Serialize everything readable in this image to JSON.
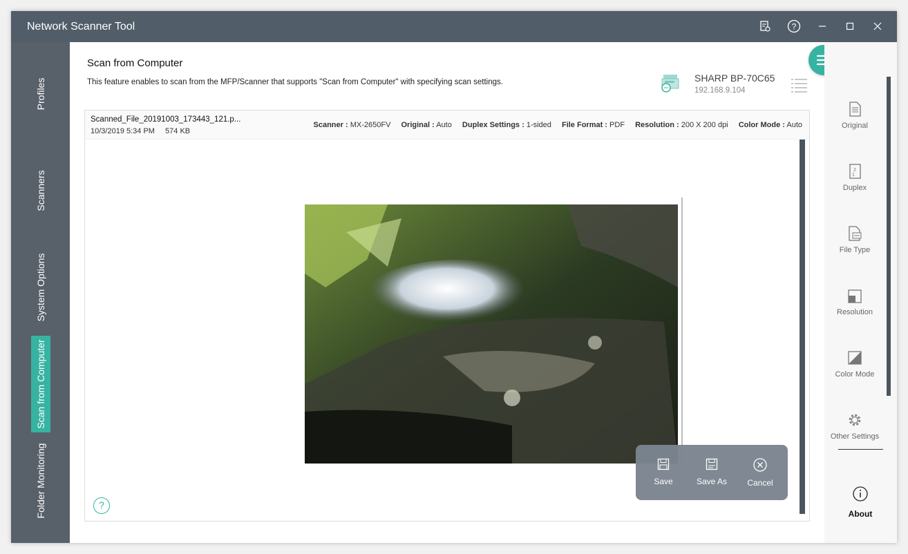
{
  "app": {
    "title": "Network Scanner Tool"
  },
  "titlebar_icons": [
    "license-icon",
    "help-icon",
    "minimize-icon",
    "maximize-icon",
    "close-icon"
  ],
  "left_nav": {
    "tabs": [
      {
        "label": "Profiles",
        "active": false
      },
      {
        "label": "Scanners",
        "active": false
      },
      {
        "label": "System Options",
        "active": false
      },
      {
        "label": "Scan from Computer",
        "active": true
      },
      {
        "label": "Folder Monitoring",
        "active": false
      }
    ]
  },
  "page": {
    "title": "Scan from Computer",
    "description": "This feature enables to scan from the MFP/Scanner that supports \"Scan from Computer\" with specifying scan settings."
  },
  "device": {
    "name": "SHARP BP-70C65",
    "ip": "192.168.9.104"
  },
  "file": {
    "name": "Scanned_File_20191003_173443_121.p...",
    "datetime": "10/3/2019 5:34 PM",
    "size": "574 KB"
  },
  "scan_settings": {
    "scanner_label": "Scanner :",
    "scanner_value": "MX-2650FV",
    "original_label": "Original :",
    "original_value": "Auto",
    "duplex_label": "Duplex Settings :",
    "duplex_value": "1-sided",
    "format_label": "File Format :",
    "format_value": "PDF",
    "resolution_label": "Resolution :",
    "resolution_value": "200 X 200 dpi",
    "color_label": "Color Mode :",
    "color_value": "Auto"
  },
  "actions": {
    "save": "Save",
    "save_as": "Save As",
    "cancel": "Cancel"
  },
  "right_bar": {
    "items": [
      "Original",
      "Duplex",
      "File Type",
      "Resolution",
      "Color Mode",
      "Other Settings"
    ],
    "about": "About"
  },
  "colors": {
    "accent": "#37b3a2",
    "titlebar": "#515d69",
    "nav": "#58606a"
  }
}
